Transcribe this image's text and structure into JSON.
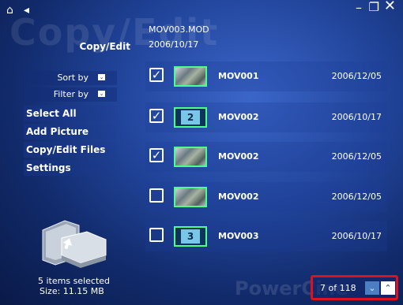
{
  "topbar": {
    "home_icon": "home-icon",
    "back_icon": "back-arrow-icon",
    "minimize": "–",
    "restore": "❐",
    "close": "✕"
  },
  "background_watermark": "Copy/Edit",
  "section_title": "Copy/Edit",
  "current": {
    "file": "MOV003.MOD",
    "date": "2006/10/17"
  },
  "sidebar": {
    "dropdowns": [
      {
        "label": "Sort by",
        "arrow": "⌄"
      },
      {
        "label": "Filter by",
        "arrow": "⌄"
      }
    ],
    "items": [
      {
        "label": "Select All"
      },
      {
        "label": "Add Picture"
      },
      {
        "label": "Copy/Edit Files"
      },
      {
        "label": "Settings"
      }
    ]
  },
  "status": {
    "selected": "5 items selected",
    "size": "Size:  11.15 MB"
  },
  "files": [
    {
      "name": "MOV001",
      "date": "2006/12/05",
      "checked": true,
      "thumb": "video",
      "mark": "✓"
    },
    {
      "name": "MOV002",
      "date": "2006/10/17",
      "checked": true,
      "thumb": "2",
      "mark": "✓"
    },
    {
      "name": "MOV002",
      "date": "2006/12/05",
      "checked": true,
      "thumb": "video",
      "mark": "✓"
    },
    {
      "name": "MOV002",
      "date": "2006/12/05",
      "checked": false,
      "thumb": "video",
      "mark": ""
    },
    {
      "name": "MOV003",
      "date": "2006/10/17",
      "checked": false,
      "thumb": "3",
      "mark": ""
    }
  ],
  "pager": {
    "text": "7 of 118",
    "down": "⌄",
    "up": "⌃"
  },
  "brand_watermark": "PowerCine"
}
